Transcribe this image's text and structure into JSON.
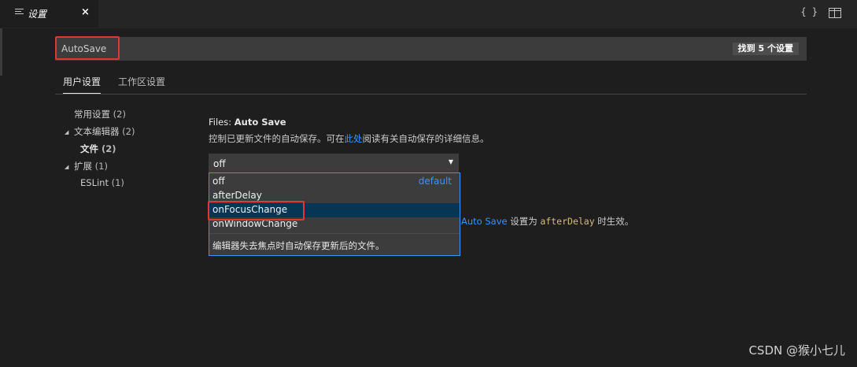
{
  "tab": {
    "label": "设置",
    "close": "×"
  },
  "editor_actions": {
    "json_label": "{ }"
  },
  "search": {
    "value": "AutoSave",
    "placeholder": "",
    "result_count": "找到 5 个设置"
  },
  "scope_tabs": [
    {
      "label": "用户设置"
    },
    {
      "label": "工作区设置"
    }
  ],
  "toc": {
    "common": {
      "label": "常用设置",
      "count": "(2)"
    },
    "text_editor": {
      "label": "文本编辑器",
      "count": "(2)"
    },
    "files": {
      "label": "文件",
      "count": "(2)"
    },
    "extensions": {
      "label": "扩展",
      "count": "(1)"
    },
    "eslint": {
      "label": "ESLint",
      "count": "(1)"
    }
  },
  "setting": {
    "category": "Files: ",
    "name": "Auto Save",
    "desc_before": "控制已更新文件的自动保存。可在",
    "desc_link": "此处",
    "desc_after": "阅读有关自动保存的详细信息。",
    "current_value": "off",
    "options": [
      {
        "label": "off",
        "tag": "default"
      },
      {
        "label": "afterDelay",
        "tag": ""
      },
      {
        "label": "onFocusChange",
        "tag": ""
      },
      {
        "label": "onWindowChange",
        "tag": ""
      }
    ],
    "option_description": "编辑器失去焦点时自动保存更新后的文件。"
  },
  "behind_setting": {
    "link": "Auto Save",
    "text_mid": " 设置为 ",
    "code": "afterDelay",
    "text_end": " 时生效。"
  },
  "watermark": "CSDN @猴小七儿",
  "colors": {
    "accent": "#3794ff",
    "highlight_box": "#e23632",
    "selected_option": "#073655"
  }
}
